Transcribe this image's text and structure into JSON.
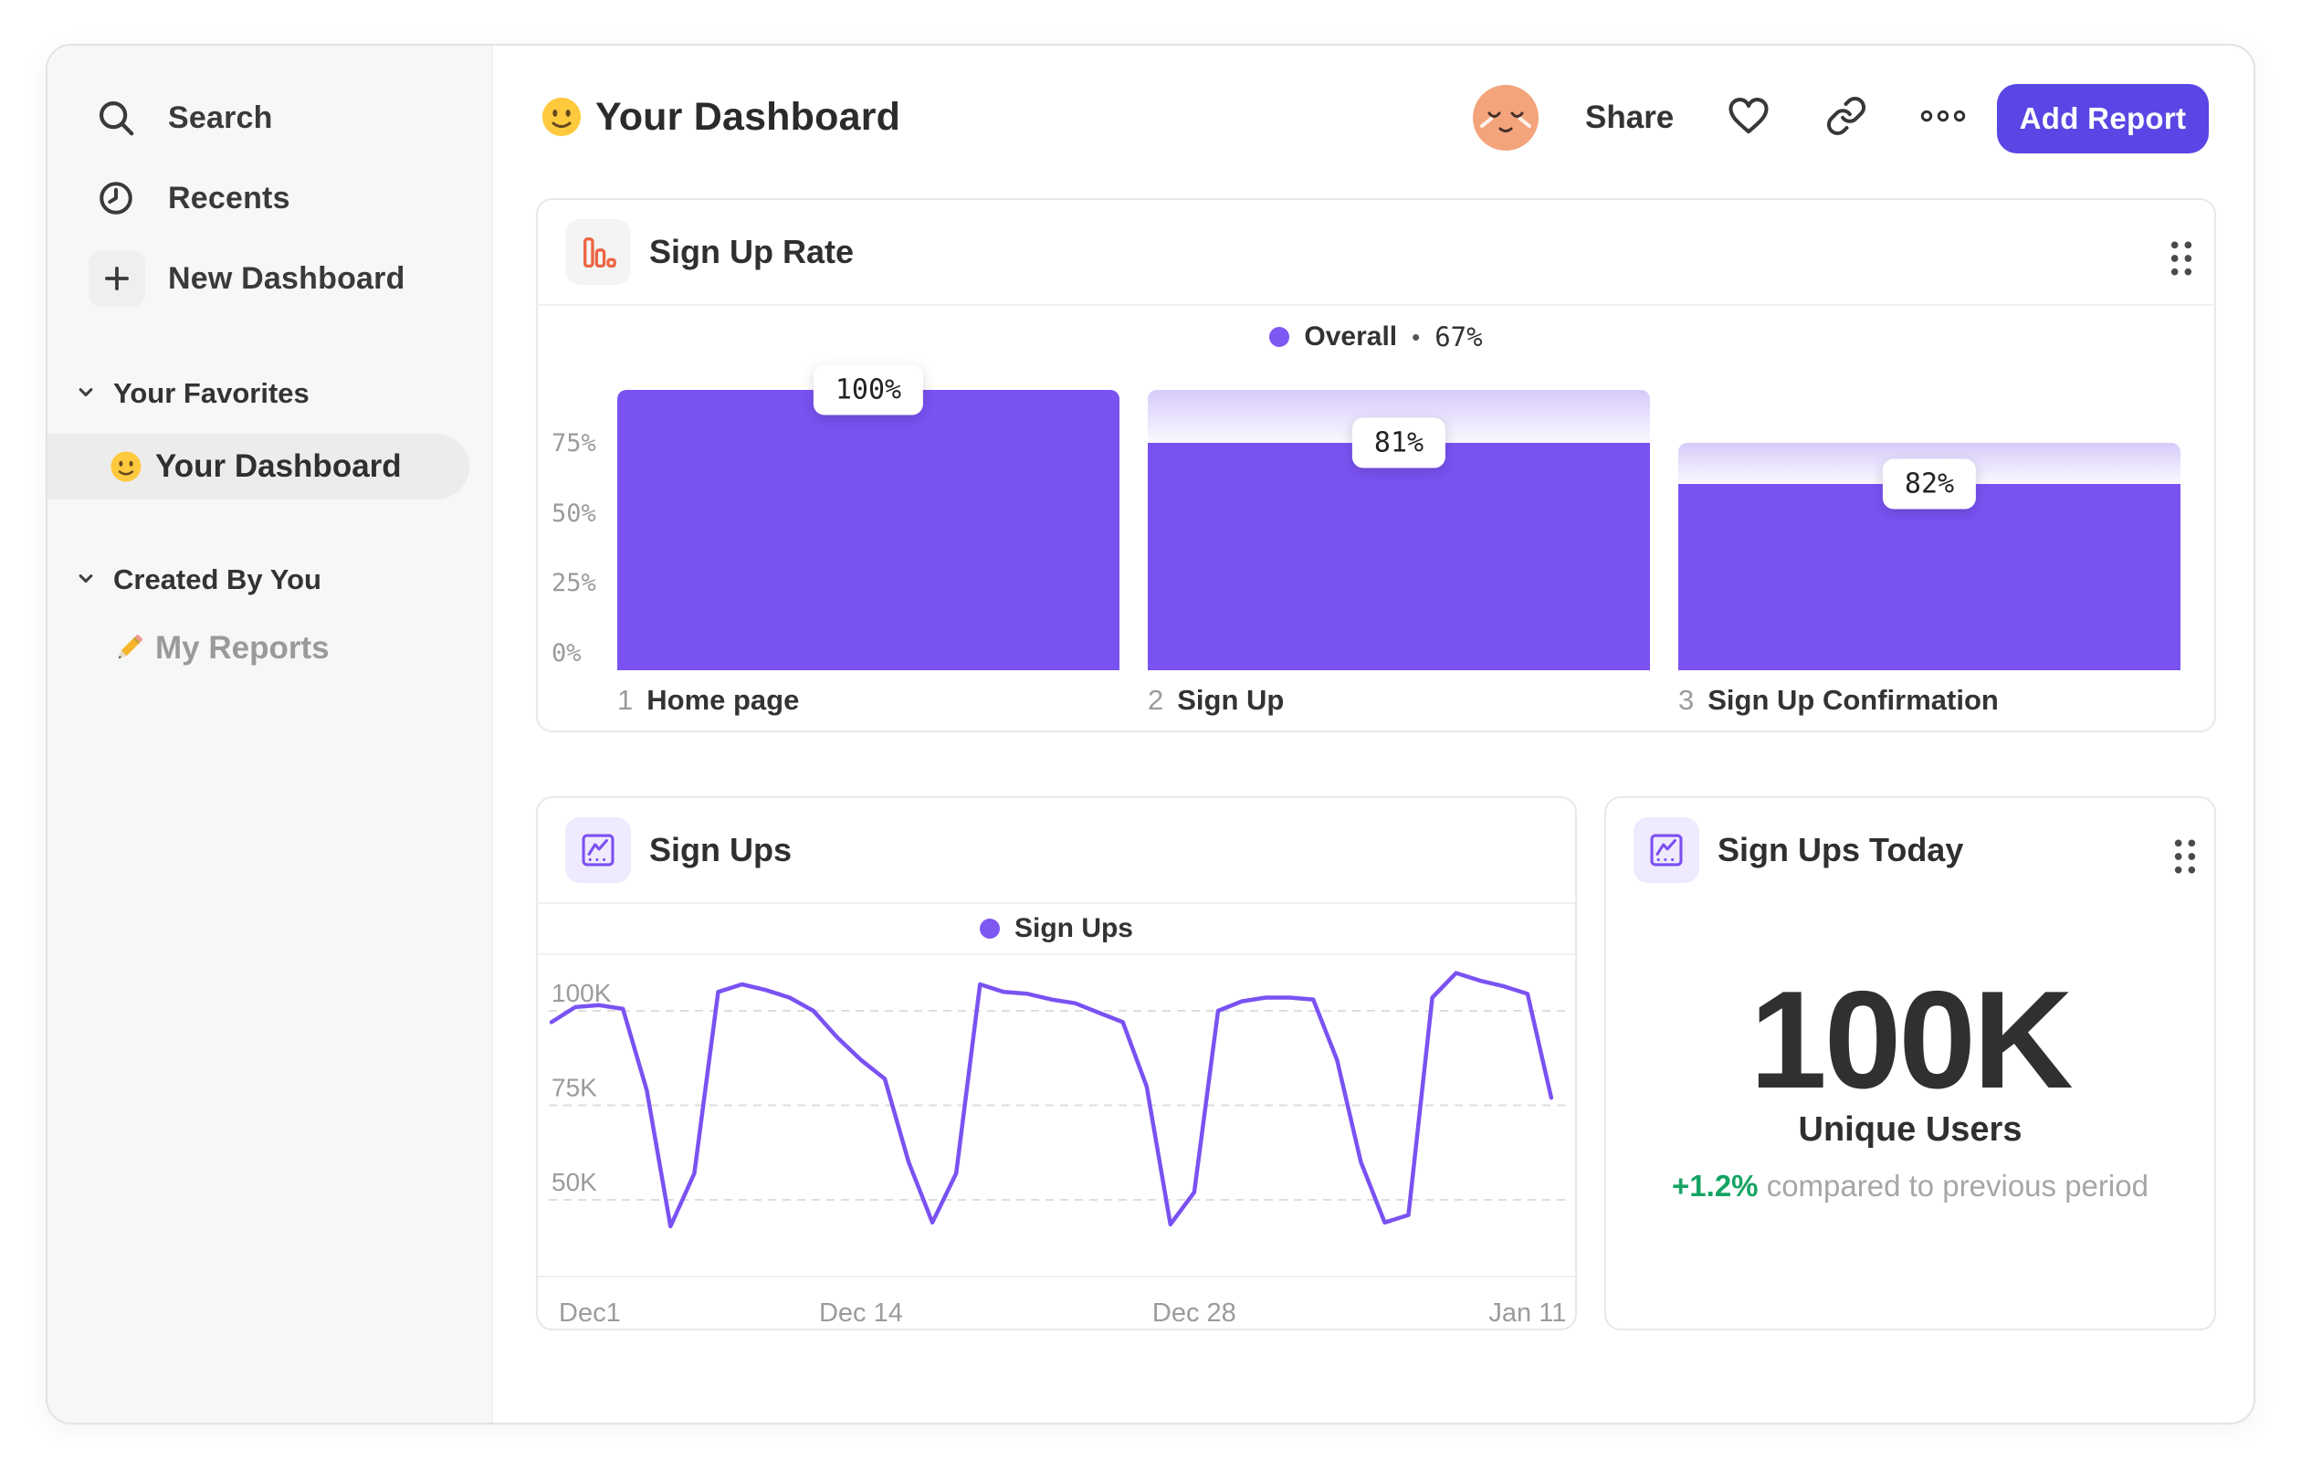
{
  "sidebar": {
    "nav": [
      {
        "label": "Search",
        "icon": "search-icon"
      },
      {
        "label": "Recents",
        "icon": "clock-icon"
      },
      {
        "label": "New Dashboard",
        "icon": "plus-icon"
      }
    ],
    "favorites_header": "Your Favorites",
    "favorites": [
      {
        "label": "Your Dashboard",
        "emoji": "slightly-smiling-face",
        "selected": true
      }
    ],
    "created_header": "Created By You",
    "created": [
      {
        "label": "My Reports",
        "emoji": "pencil"
      }
    ]
  },
  "header": {
    "emoji": "slightly-smiling-face",
    "title": "Your Dashboard",
    "share": "Share",
    "add_report": "Add Report"
  },
  "cards": {
    "signup_rate": {
      "title": "Sign Up Rate",
      "icon": "bar-chart-icon",
      "legend_label": "Overall",
      "legend_sep": "•",
      "legend_value": "67%"
    },
    "sign_ups": {
      "title": "Sign Ups",
      "icon": "line-chart-icon",
      "legend_label": "Sign Ups"
    },
    "sign_ups_today": {
      "title": "Sign Ups Today",
      "icon": "line-chart-icon",
      "value": "100K",
      "metric_label": "Unique Users",
      "change": "+1.2%",
      "change_note": "compared to previous period"
    }
  },
  "chart_data": [
    {
      "type": "bar",
      "title": "Sign Up Rate",
      "legend": "Overall • 67%",
      "categories": [
        "Home page",
        "Sign Up",
        "Sign Up Confirmation"
      ],
      "step_numbers": [
        "1",
        "2",
        "3"
      ],
      "values_pct_overall": [
        100,
        81,
        66.4
      ],
      "prev_pct_overall": [
        null,
        100,
        81
      ],
      "step_conversion_labels": [
        "100%",
        "81%",
        "82%"
      ],
      "y_ticks": [
        "75%",
        "50%",
        "25%",
        "0%"
      ],
      "y_tick_values": [
        75,
        50,
        25,
        0
      ],
      "ylim": [
        0,
        100
      ],
      "bar_color": "#7a52f2"
    },
    {
      "type": "line",
      "title": "Sign Ups",
      "series": [
        {
          "name": "Sign Ups",
          "values": [
            97,
            101,
            101.5,
            100.5,
            79,
            43,
            57,
            105,
            107,
            105.5,
            103.5,
            100,
            93,
            87,
            82,
            60,
            44,
            57,
            107,
            105,
            104.5,
            103,
            102,
            99.5,
            97,
            80,
            43.5,
            52,
            100,
            102.5,
            103.5,
            103.5,
            103,
            87,
            60,
            44,
            46,
            103.5,
            110,
            108,
            106.5,
            104.5,
            77
          ]
        }
      ],
      "y_unit": "K",
      "x_range": "Dec 1 – Jan 12",
      "x_labels": [
        "Dec1",
        "Dec 14",
        "Dec 28",
        "Jan 11"
      ],
      "x_label_positions": [
        0,
        13,
        27,
        41
      ],
      "y_ticks": [
        "100K",
        "75K",
        "50K"
      ],
      "y_tick_values": [
        100,
        75,
        50
      ],
      "ylim": [
        30,
        113
      ],
      "grid": "dashed-horizontal",
      "line_color": "#7a52f2",
      "legend_position": "top-center"
    }
  ],
  "colors": {
    "accent_purple": "#7a52f2",
    "button_indigo": "#5a46e4",
    "icon_orange": "#ed6443",
    "green_positive": "#15a463",
    "sidebar_bg": "#f7f7f7",
    "selected_pill": "#ececec",
    "text_dark": "#2f2f2f",
    "text_gray": "#9b9b9b"
  }
}
